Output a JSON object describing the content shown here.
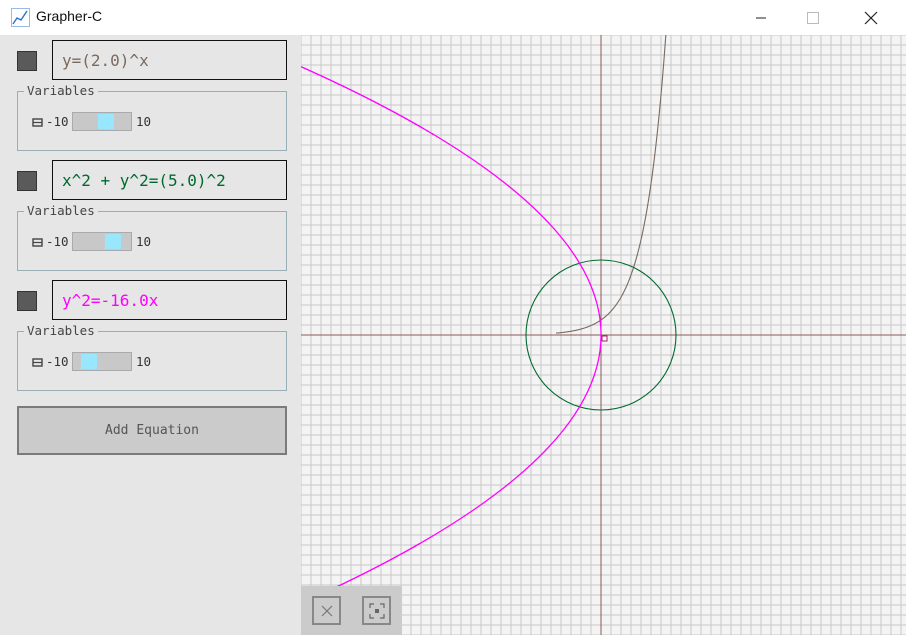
{
  "window": {
    "title": "Grapher-C"
  },
  "icons": {
    "app": "graph-app-icon",
    "minimize": "minimize-icon",
    "maximize": "maximize-icon",
    "close": "close-icon",
    "variable": "variable-icon",
    "clear": "clear-icon",
    "recenter": "recenter-icon"
  },
  "equations": [
    {
      "text": "y=(2.0)^x",
      "color": "#7a6a60",
      "variables_label": "Variables",
      "min": "-10",
      "max": "10",
      "slider_value": 0.6
    },
    {
      "text": "x^2 + y^2=(5.0)^2",
      "color": "#006a2e",
      "variables_label": "Variables",
      "min": "-10",
      "max": "10",
      "slider_value": 0.75
    },
    {
      "text": "y^2=-16.0x",
      "color": "#ff00ff",
      "variables_label": "Variables",
      "min": "-10",
      "max": "10",
      "slider_value": 0.2
    }
  ],
  "add_button": {
    "label": "Add Equation"
  },
  "colors": {
    "panel_bg": "#e6e6e6",
    "grid": "#c8c8c8",
    "axis": "#8a5a5a",
    "slider_thumb": "#99e6ff"
  }
}
